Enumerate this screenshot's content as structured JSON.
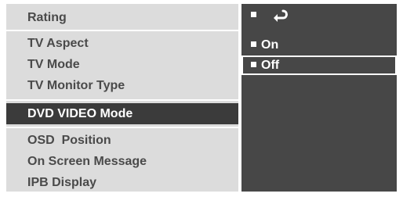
{
  "menu": {
    "items": [
      {
        "label": "Rating",
        "selected": false
      },
      {
        "label": "TV Aspect",
        "selected": false
      },
      {
        "label": "TV Mode",
        "selected": false
      },
      {
        "label": "TV Monitor Type",
        "selected": false
      },
      {
        "label": "DVD VIDEO Mode",
        "selected": true
      },
      {
        "label": "OSD  Position",
        "selected": false
      },
      {
        "label": "On Screen Message",
        "selected": false
      },
      {
        "label": "IPB Display",
        "selected": false
      }
    ]
  },
  "options": {
    "return_icon": "return-arrow-icon",
    "items": [
      {
        "label": "On",
        "highlighted": false
      },
      {
        "label": "Off",
        "highlighted": true
      }
    ]
  },
  "colors": {
    "menu_bg": "#dcdcdc",
    "menu_text": "#4a4a4a",
    "selected_bg": "#3b3b3b",
    "options_bg": "#474747",
    "options_text": "#ffffff"
  }
}
